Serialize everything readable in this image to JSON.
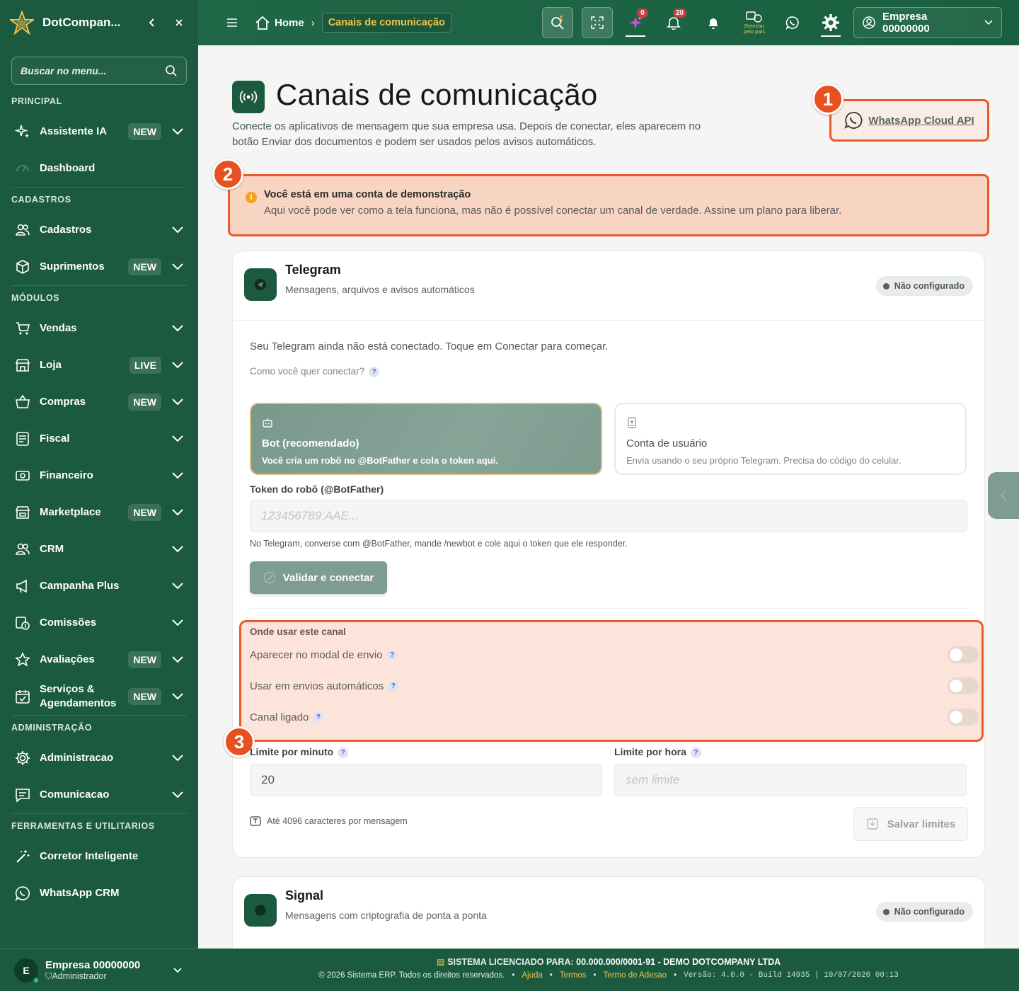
{
  "sidebar": {
    "brand": "DotCompan...",
    "search_placeholder": "Buscar no menu...",
    "sections": {
      "principal": "PRINCIPAL",
      "cadastros": "CADASTROS",
      "modulos": "MÓDULOS",
      "administracao": "ADMINISTRAÇÃO",
      "ferramentas": "FERRAMENTAS E UTILITARIOS"
    },
    "items": [
      {
        "label": "Assistente IA",
        "badge": "NEW"
      },
      {
        "label": "Dashboard"
      },
      {
        "label": "Cadastros"
      },
      {
        "label": "Suprimentos",
        "badge": "NEW"
      },
      {
        "label": "Vendas"
      },
      {
        "label": "Loja",
        "badge": "LIVE"
      },
      {
        "label": "Compras",
        "badge": "NEW"
      },
      {
        "label": "Fiscal"
      },
      {
        "label": "Financeiro"
      },
      {
        "label": "Marketplace",
        "badge": "NEW"
      },
      {
        "label": "CRM"
      },
      {
        "label": "Campanha Plus"
      },
      {
        "label": "Comissões"
      },
      {
        "label": "Avaliações",
        "badge": "NEW"
      },
      {
        "label": "Serviços & Agendamentos",
        "badge": "NEW"
      },
      {
        "label": "Administracao"
      },
      {
        "label": "Comunicacao"
      },
      {
        "label": "Corretor Inteligente"
      },
      {
        "label": "WhatsApp CRM"
      }
    ],
    "user": {
      "initial": "E",
      "name": "Empresa 00000000",
      "role": "Administrador"
    }
  },
  "topbar": {
    "home": "Home",
    "current": "Canais de comunicação",
    "ai_count": "0",
    "notif_count": "20",
    "detect_label": "Detectar pelo país",
    "account": "Empresa 00000000"
  },
  "page": {
    "title": "Canais de comunicação",
    "description": "Conecte os aplicativos de mensagem que sua empresa usa. Depois de conectar, eles aparecem no botão Enviar dos documentos e podem ser usados pelos avisos automáticos.",
    "whatsapp_button": "WhatsApp Cloud API",
    "markers": [
      "1",
      "2",
      "3"
    ],
    "demo": {
      "title": "Você está em uma conta de demonstração",
      "text": "Aqui você pode ver como a tela funciona, mas não é possível conectar um canal de verdade. Assine um plano para liberar."
    }
  },
  "telegram": {
    "title": "Telegram",
    "subtitle": "Mensagens, arquivos e avisos automáticos",
    "status": "Não configurado",
    "intro": "Seu Telegram ainda não está conectado. Toque em Conectar para começar.",
    "how_label": "Como você quer conectar?",
    "options": [
      {
        "title": "Bot (recomendado)",
        "desc": "Você cria um robô no @BotFather e cola o token aqui.",
        "selected": true
      },
      {
        "title": "Conta de usuário",
        "desc": "Envia usando o seu próprio Telegram. Precisa do código do celular.",
        "selected": false
      }
    ],
    "token_label": "Token do robô (@BotFather)",
    "token_placeholder": "123456789:AAE...",
    "token_help": "No Telegram, converse com @BotFather, mande /newbot e cole aqui o token que ele responder.",
    "validate_button": "Validar e conectar",
    "where_title": "Onde usar este canal",
    "toggles": [
      {
        "label": "Aparecer no modal de envio",
        "on": false
      },
      {
        "label": "Usar em envios automáticos",
        "on": false
      },
      {
        "label": "Canal ligado",
        "on": false
      }
    ],
    "limit_minute_label": "Limite por minuto",
    "limit_minute_value": "20",
    "limit_hour_label": "Limite por hora",
    "limit_hour_placeholder": "sem limite",
    "chars_note": "Até 4096 caracteres por mensagem",
    "save_button": "Salvar limites"
  },
  "signal": {
    "title": "Signal",
    "subtitle": "Mensagens com criptografia de ponta a ponta",
    "status": "Não configurado"
  },
  "footer": {
    "license_label": "SISTEMA LICENCIADO PARA:",
    "license_value": "00.000.000/0001-91 - DEMO DOTCOMPANY LTDA",
    "copyright": "© 2026 Sistema ERP. Todos os direitos reservados.",
    "links": [
      "Ajuda",
      "Termos",
      "Termo de Adesao"
    ],
    "version": "Versão: 4.0.0 - Build 14935 | 10/07/2026 00:13"
  },
  "colors": {
    "primary": "#1b5a3f",
    "accent": "#f0c34a",
    "highlight": "#e85a2a"
  }
}
